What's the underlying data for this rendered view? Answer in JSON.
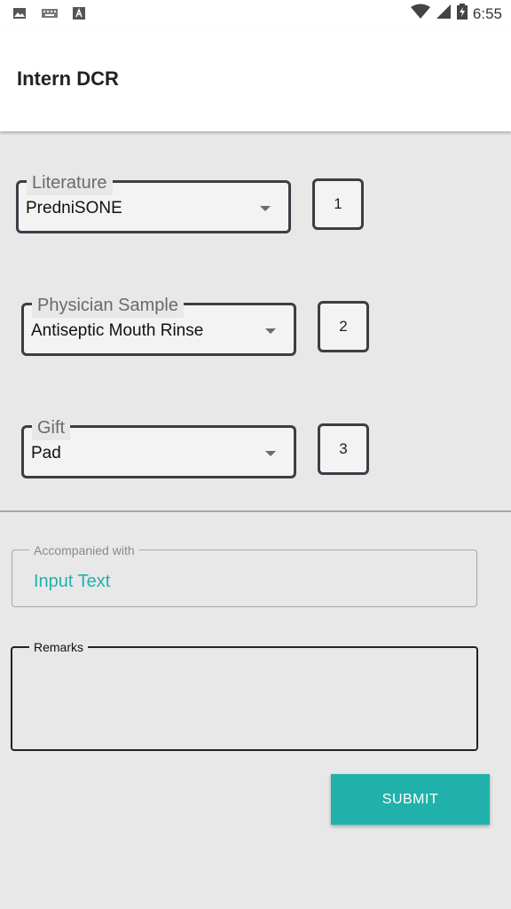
{
  "status_bar": {
    "time": "6:55",
    "left_icons": [
      "image-icon",
      "keyboard-icon",
      "a-icon"
    ],
    "right_icons": [
      "wifi-icon",
      "signal-icon",
      "battery-icon"
    ]
  },
  "app_bar": {
    "title": "Intern DCR"
  },
  "items": [
    {
      "label": "Literature",
      "value": "PredniSONE",
      "quantity": "1"
    },
    {
      "label": "Physician Sample",
      "value": "Antiseptic Mouth Rinse",
      "quantity": "2"
    },
    {
      "label": "Gift",
      "value": "Pad",
      "quantity": "3"
    }
  ],
  "accompanied": {
    "label": "Accompanied with",
    "placeholder": "Input Text"
  },
  "remarks": {
    "label": "Remarks",
    "value": ""
  },
  "submit_label": "SUBMIT",
  "colors": {
    "accent": "#20b2aa",
    "outline": "#3e3c45",
    "background": "#e8e8e8"
  }
}
